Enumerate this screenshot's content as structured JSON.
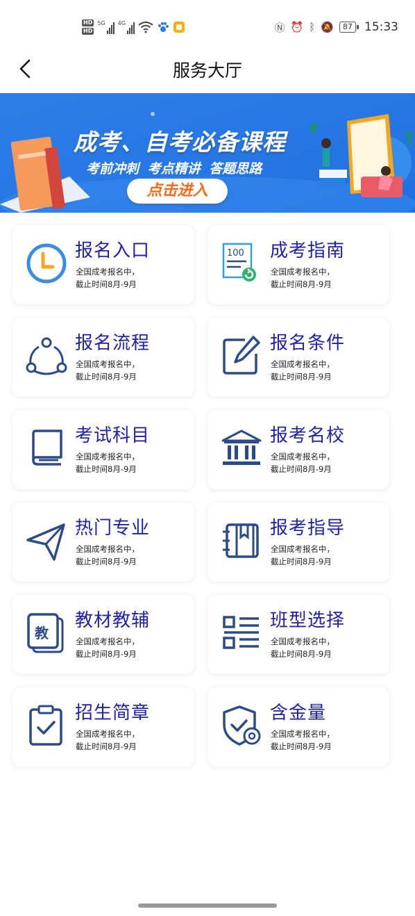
{
  "status_bar": {
    "hd1": "HD",
    "hd2": "HD",
    "net1": "5G",
    "net2": "4G",
    "battery": "87",
    "time": "15:33"
  },
  "nav": {
    "title": "服务大厅"
  },
  "banner": {
    "title": "成考、自考必备课程",
    "subtitle": "考前冲刺  考点精讲  答题思路",
    "button": "点击进入"
  },
  "cards": [
    {
      "title": "报名入口",
      "line1": "全国成考报名中，",
      "line2": "截止时间8月-9月",
      "icon": "clock-icon"
    },
    {
      "title": "成考指南",
      "line1": "全国成考报名中，",
      "line2": "截止时间8月-9月",
      "icon": "score-doc-icon",
      "icon_text": "100"
    },
    {
      "title": "报名流程",
      "line1": "全国成考报名中，",
      "line2": "截止时间8月-9月",
      "icon": "share-nodes-icon"
    },
    {
      "title": "报名条件",
      "line1": "全国成考报名中，",
      "line2": "截止时间8月-9月",
      "icon": "edit-icon"
    },
    {
      "title": "考试科目",
      "line1": "全国成考报名中，",
      "line2": "截止时间8月-9月",
      "icon": "book-icon"
    },
    {
      "title": "报考名校",
      "line1": "全国成考报名中，",
      "line2": "截止时间8月-9月",
      "icon": "school-building-icon"
    },
    {
      "title": "热门专业",
      "line1": "全国成考报名中，",
      "line2": "截止时间8月-9月",
      "icon": "paper-plane-icon"
    },
    {
      "title": "报考指导",
      "line1": "全国成考报名中，",
      "line2": "截止时间8月-9月",
      "icon": "notebook-icon"
    },
    {
      "title": "教材教辅",
      "line1": "全国成考报名中，",
      "line2": "截止时间8月-9月",
      "icon": "textbook-icon",
      "icon_text": "教"
    },
    {
      "title": "班型选择",
      "line1": "全国成考报名中，",
      "line2": "截止时间8月-9月",
      "icon": "list-icon"
    },
    {
      "title": "招生简章",
      "line1": "全国成考报名中，",
      "line2": "截止时间8月-9月",
      "icon": "clipboard-check-icon"
    },
    {
      "title": "含金量",
      "line1": "全国成考报名中，",
      "line2": "截止时间8月-9月",
      "icon": "shield-gear-icon"
    }
  ],
  "colors": {
    "card_title": "#1f1fa8",
    "icon_navy": "#2b4a86",
    "accent_blue": "#3b8de0",
    "banner_blue": "#2f7ee6",
    "button_orange": "#f36b1c"
  }
}
